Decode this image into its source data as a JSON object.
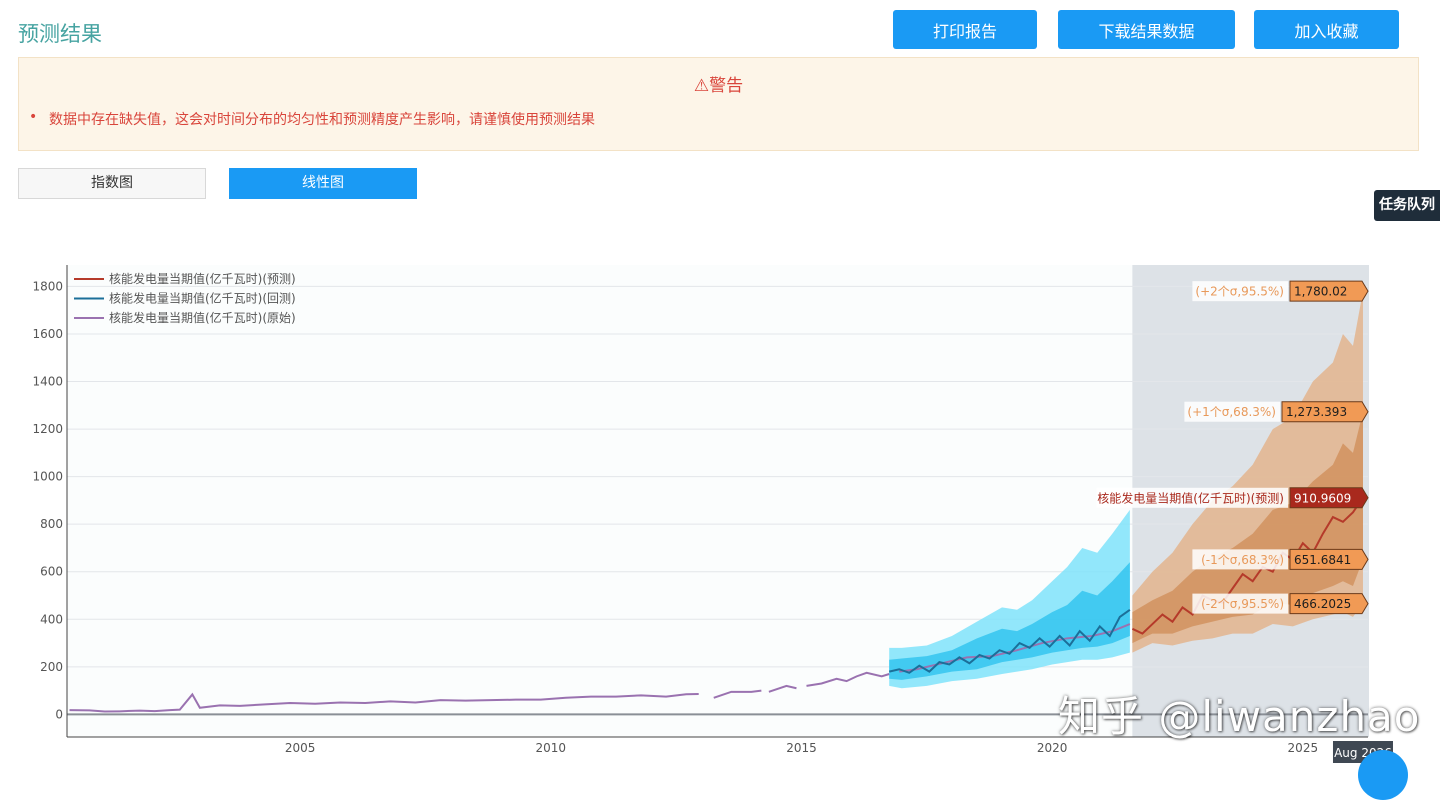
{
  "header": {
    "title": "预测结果",
    "buttons": {
      "print": "打印报告",
      "download": "下载结果数据",
      "favorite": "加入收藏"
    }
  },
  "alert": {
    "title": "⚠警告",
    "message": "数据中存在缺失值，这会对时间分布的均匀性和预测精度产生影响，请谨慎使用预测结果"
  },
  "tabs": {
    "index": "指数图",
    "linear": "线性图"
  },
  "side_tab": "任务队列",
  "watermark": "知乎 @liwanzhao",
  "chart_data": {
    "type": "line",
    "legend": [
      {
        "name": "核能发电量当期值(亿千瓦时)(预测)",
        "color": "#b53a2a"
      },
      {
        "name": "核能发电量当期值(亿千瓦时)(回测)",
        "color": "#1b6f99"
      },
      {
        "name": "核能发电量当期值(亿千瓦时)(原始)",
        "color": "#9a72b0"
      }
    ],
    "legend_position": "top-left",
    "grid": true,
    "x_ticks": [
      2005,
      2010,
      2015,
      2020,
      2025
    ],
    "y_ticks": [
      0,
      200,
      400,
      600,
      800,
      1000,
      1200,
      1400,
      1600,
      1800
    ],
    "xlim": [
      2000.35,
      2026.3
    ],
    "ylim": [
      -95,
      1890
    ],
    "forecast_region": [
      2021.6,
      2026.2
    ],
    "hover_x_label": "Aug 2026",
    "hover_labels": [
      {
        "text": "(+2个σ,95.5%)",
        "value": "1,780.02",
        "y": 1780,
        "color": "#f19a55",
        "textcolor": "#e8995a"
      },
      {
        "text": "(+1个σ,68.3%)",
        "value": "1,273.393",
        "y": 1273,
        "color": "#f19a55",
        "textcolor": "#e8995a"
      },
      {
        "text": "核能发电量当期值(亿千瓦时)(预测)",
        "value": "910.9609",
        "y": 911,
        "color": "#a9291d",
        "textcolor": "#a9291d"
      },
      {
        "text": "(-1个σ,68.3%)",
        "value": "651.6841",
        "y": 652,
        "color": "#f19a55",
        "textcolor": "#e8995a"
      },
      {
        "text": "(-2个σ,95.5%)",
        "value": "466.2025",
        "y": 466,
        "color": "#f19a55",
        "textcolor": "#e8995a"
      }
    ],
    "original_series": {
      "name": "核能发电量当期值(亿千瓦时)(原始)",
      "segments": [
        [
          [
            2000.4,
            18
          ],
          [
            2000.8,
            17
          ],
          [
            2001.1,
            12
          ],
          [
            2001.4,
            13
          ],
          [
            2001.8,
            16
          ],
          [
            2002.1,
            14
          ],
          [
            2002.4,
            18
          ],
          [
            2002.6,
            20
          ],
          [
            2002.85,
            84
          ],
          [
            2003.0,
            28
          ],
          [
            2003.4,
            38
          ],
          [
            2003.8,
            36
          ],
          [
            2004.3,
            42
          ],
          [
            2004.8,
            48
          ],
          [
            2005.3,
            45
          ],
          [
            2005.8,
            50
          ],
          [
            2006.3,
            48
          ],
          [
            2006.8,
            55
          ],
          [
            2007.3,
            50
          ],
          [
            2007.8,
            60
          ],
          [
            2008.3,
            58
          ],
          [
            2008.8,
            60
          ],
          [
            2009.3,
            62
          ],
          [
            2009.8,
            62
          ],
          [
            2010.3,
            70
          ],
          [
            2010.8,
            75
          ],
          [
            2011.3,
            75
          ],
          [
            2011.8,
            80
          ],
          [
            2012.3,
            75
          ],
          [
            2012.7,
            85
          ],
          [
            2012.95,
            86
          ]
        ],
        [
          [
            2013.25,
            70
          ],
          [
            2013.6,
            95
          ],
          [
            2014.0,
            95
          ],
          [
            2014.2,
            100
          ]
        ],
        [
          [
            2014.35,
            95
          ],
          [
            2014.7,
            120
          ],
          [
            2014.9,
            110
          ]
        ],
        [
          [
            2015.1,
            120
          ],
          [
            2015.4,
            130
          ],
          [
            2015.7,
            150
          ],
          [
            2015.9,
            140
          ],
          [
            2016.1,
            160
          ],
          [
            2016.3,
            175
          ],
          [
            2016.6,
            160
          ],
          [
            2016.75,
            170
          ]
        ],
        [
          [
            2016.95,
            180
          ],
          [
            2017.3,
            190
          ],
          [
            2017.8,
            215
          ],
          [
            2018.3,
            240
          ],
          [
            2018.8,
            245
          ],
          [
            2019.3,
            270
          ],
          [
            2019.8,
            300
          ],
          [
            2020.3,
            320
          ],
          [
            2020.8,
            330
          ],
          [
            2021.2,
            350
          ],
          [
            2021.55,
            380
          ]
        ]
      ]
    },
    "backtest_series": {
      "name": "核能发电量当期值(亿千瓦时)(回测)",
      "x": [
        2016.75,
        2016.95,
        2017.15,
        2017.35,
        2017.55,
        2017.75,
        2017.95,
        2018.15,
        2018.35,
        2018.55,
        2018.75,
        2018.95,
        2019.15,
        2019.35,
        2019.55,
        2019.75,
        2019.95,
        2020.15,
        2020.35,
        2020.55,
        2020.75,
        2020.95,
        2021.15,
        2021.35,
        2021.55
      ],
      "y": [
        180,
        190,
        175,
        205,
        180,
        220,
        210,
        240,
        215,
        250,
        235,
        270,
        255,
        300,
        280,
        320,
        285,
        330,
        290,
        350,
        310,
        370,
        330,
        410,
        440
      ]
    },
    "backtest_band_outer": {
      "x": [
        2016.75,
        2017.0,
        2017.5,
        2018.0,
        2018.5,
        2019.0,
        2019.3,
        2019.6,
        2020.0,
        2020.3,
        2020.6,
        2020.9,
        2021.2,
        2021.55
      ],
      "upper": [
        280,
        280,
        290,
        330,
        390,
        450,
        440,
        480,
        560,
        620,
        700,
        680,
        760,
        860
      ],
      "lower": [
        120,
        110,
        120,
        140,
        150,
        170,
        180,
        190,
        210,
        220,
        230,
        230,
        240,
        260
      ]
    },
    "backtest_band_inner": {
      "x": [
        2016.75,
        2017.0,
        2017.5,
        2018.0,
        2018.5,
        2019.0,
        2019.3,
        2019.6,
        2020.0,
        2020.3,
        2020.6,
        2020.9,
        2021.2,
        2021.55
      ],
      "upper": [
        230,
        235,
        245,
        270,
        320,
        360,
        350,
        380,
        430,
        460,
        520,
        500,
        560,
        640
      ],
      "lower": [
        150,
        145,
        160,
        180,
        190,
        220,
        230,
        240,
        260,
        270,
        280,
        285,
        300,
        330
      ]
    },
    "forecast_series": {
      "name": "核能发电量当期值(亿千瓦时)(预测)",
      "x": [
        2021.6,
        2021.8,
        2022.0,
        2022.2,
        2022.4,
        2022.6,
        2022.8,
        2023.0,
        2023.2,
        2023.4,
        2023.6,
        2023.8,
        2024.0,
        2024.2,
        2024.4,
        2024.6,
        2024.8,
        2025.0,
        2025.2,
        2025.4,
        2025.6,
        2025.8,
        2026.0,
        2026.2
      ],
      "y": [
        360,
        340,
        380,
        420,
        390,
        450,
        420,
        500,
        480,
        470,
        530,
        590,
        560,
        620,
        600,
        680,
        650,
        720,
        680,
        760,
        830,
        810,
        850,
        911
      ]
    },
    "forecast_band_outer": {
      "x": [
        2021.6,
        2022.0,
        2022.4,
        2022.8,
        2023.2,
        2023.6,
        2024.0,
        2024.4,
        2024.8,
        2025.2,
        2025.6,
        2025.8,
        2026.0,
        2026.2
      ],
      "upper": [
        500,
        600,
        680,
        800,
        900,
        960,
        1050,
        1200,
        1250,
        1400,
        1480,
        1600,
        1550,
        1780
      ],
      "lower": [
        260,
        300,
        290,
        310,
        320,
        340,
        340,
        380,
        370,
        400,
        420,
        430,
        410,
        466
      ]
    },
    "forecast_band_inner": {
      "x": [
        2021.6,
        2022.0,
        2022.4,
        2022.8,
        2023.2,
        2023.6,
        2024.0,
        2024.4,
        2024.8,
        2025.2,
        2025.6,
        2025.8,
        2026.0,
        2026.2
      ],
      "upper": [
        430,
        480,
        520,
        600,
        660,
        700,
        760,
        860,
        890,
        980,
        1050,
        1140,
        1100,
        1273
      ],
      "lower": [
        300,
        340,
        340,
        370,
        390,
        410,
        420,
        470,
        460,
        510,
        540,
        560,
        540,
        652
      ]
    }
  },
  "colors": {
    "accent": "#1a9af4",
    "title": "#46a3a1",
    "warning": "#d9453b",
    "backtest_band_outer": "#7fe3fa",
    "backtest_band_inner": "#34c4ee",
    "forecast_band_outer": "#e2b792",
    "forecast_band_inner": "#d39563",
    "forecast_region": "#dde2e7"
  }
}
